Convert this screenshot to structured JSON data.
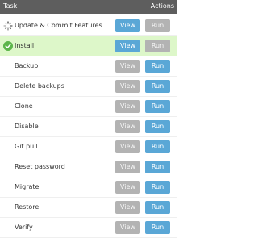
{
  "header": {
    "task": "Task",
    "actions": "Actions"
  },
  "rows": [
    {
      "label": "Update & Commit Features",
      "status": "in-progress",
      "icon": "spinner-icon",
      "view": "View",
      "run": "Run",
      "view_state": "enabled",
      "run_state": "disabled"
    },
    {
      "label": "Install",
      "status": "done",
      "icon": "check-circle-icon",
      "view": "View",
      "run": "Run",
      "view_state": "enabled",
      "run_state": "disabled"
    },
    {
      "label": "Backup",
      "view": "View",
      "run": "Run",
      "view_state": "disabled",
      "run_state": "enabled"
    },
    {
      "label": "Delete backups",
      "view": "View",
      "run": "Run",
      "view_state": "disabled",
      "run_state": "enabled"
    },
    {
      "label": "Clone",
      "view": "View",
      "run": "Run",
      "view_state": "disabled",
      "run_state": "enabled"
    },
    {
      "label": "Disable",
      "view": "View",
      "run": "Run",
      "view_state": "disabled",
      "run_state": "enabled"
    },
    {
      "label": "Git pull",
      "view": "View",
      "run": "Run",
      "view_state": "disabled",
      "run_state": "enabled"
    },
    {
      "label": "Reset password",
      "view": "View",
      "run": "Run",
      "view_state": "disabled",
      "run_state": "enabled"
    },
    {
      "label": "Migrate",
      "view": "View",
      "run": "Run",
      "view_state": "disabled",
      "run_state": "enabled"
    },
    {
      "label": "Restore",
      "view": "View",
      "run": "Run",
      "view_state": "disabled",
      "run_state": "enabled"
    },
    {
      "label": "Verify",
      "view": "View",
      "run": "Run",
      "view_state": "disabled",
      "run_state": "enabled"
    }
  ],
  "colors": {
    "header_bg": "#5e5e5e",
    "active_row_bg": "#ddf7c9",
    "button_blue": "#5aa7d6",
    "button_gray": "#b3b3b3",
    "check_green": "#5cb54a"
  }
}
